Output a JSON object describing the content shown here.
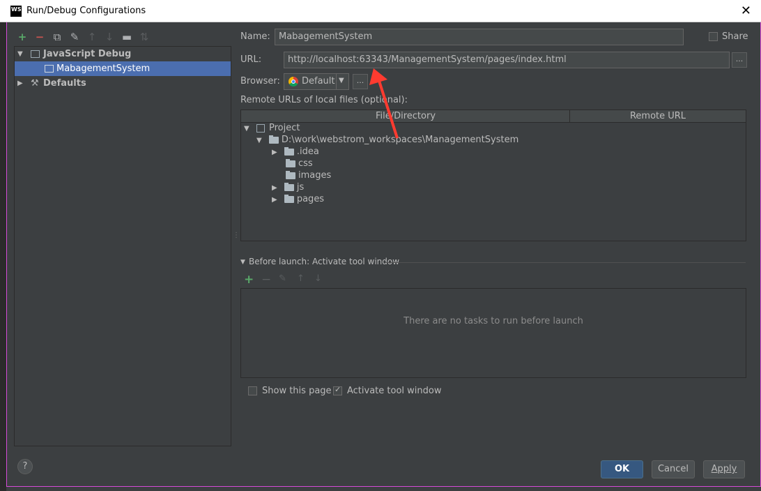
{
  "window": {
    "title": "Run/Debug Configurations"
  },
  "toolbar": {
    "icons": [
      "add-icon",
      "remove-icon",
      "copy-icon",
      "edit-defaults-icon",
      "move-up-icon",
      "move-down-icon",
      "folder-icon",
      "sort-icon"
    ]
  },
  "tree": {
    "group_label": "JavaScript Debug",
    "selected_item": "MabagementSystem",
    "defaults_label": "Defaults"
  },
  "form": {
    "name_label": "Name:",
    "name_value": "MabagementSystem",
    "share_label": "Share",
    "url_label": "URL:",
    "url_value": "http://localhost:63343/ManagementSystem/pages/index.html",
    "browser_label": "Browser:",
    "browser_value": "Default",
    "ellipsis": "...",
    "remote_urls_label": "Remote URLs of local files (optional):"
  },
  "table": {
    "columns": [
      "File/Directory",
      "Remote URL"
    ],
    "root": "Project",
    "workspace": "D:\\work\\webstrom_workspaces\\ManagementSystem",
    "folders": [
      ".idea",
      "css",
      "images",
      "js",
      "pages"
    ]
  },
  "before_launch": {
    "title": "Before launch: Activate tool window",
    "empty_text": "There are no tasks to run before launch"
  },
  "options": {
    "show_page_label": "Show this page",
    "activate_tool_label": "Activate tool window"
  },
  "buttons": {
    "ok": "OK",
    "cancel": "Cancel",
    "apply": "Apply",
    "help": "?"
  },
  "colors": {
    "accent": "#4b6eaf",
    "annotation_arrow": "#ff3b30",
    "background": "#3c3f41"
  }
}
